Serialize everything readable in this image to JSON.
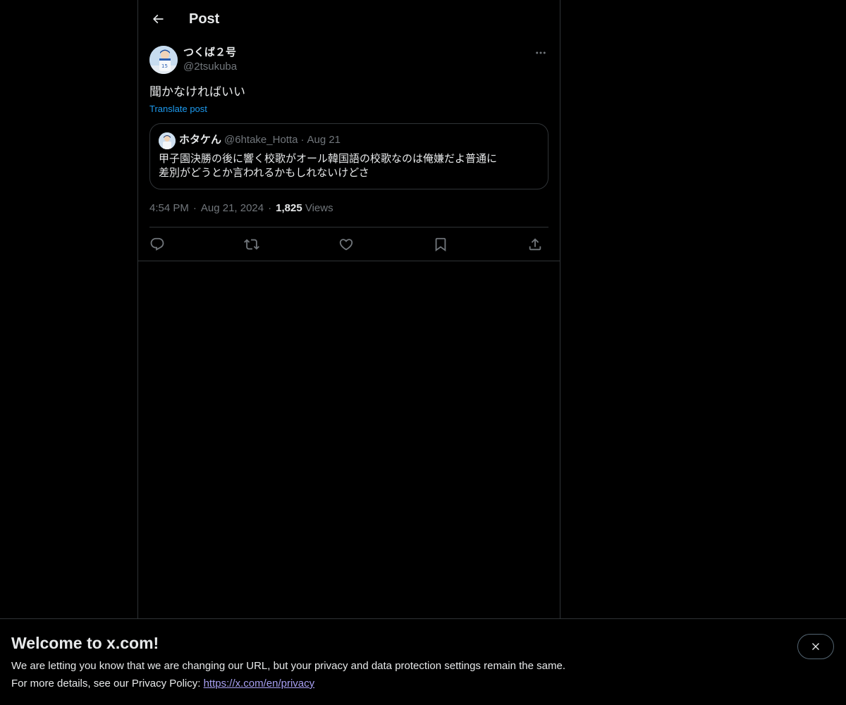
{
  "header": {
    "back_icon": "arrow-left-icon",
    "title": "Post"
  },
  "post": {
    "author_name": "つくば２号",
    "author_handle": "@2tsukuba",
    "text": "聞かなければいい",
    "translate_label": "Translate post",
    "time": "4:54 PM",
    "date": "Aug 21, 2024",
    "views_count": "1,825",
    "views_label": "Views",
    "separator": "·"
  },
  "quote": {
    "author_name": "ホタケん",
    "author_handle": "@6htake_Hotta",
    "separator": "·",
    "date": "Aug 21",
    "text_line1": "甲子園決勝の後に響く校歌がオール韓国語の校歌なのは俺嫌だよ普通に",
    "text_line2": "差別がどうとか言われるかもしれないけどさ"
  },
  "actions": {
    "reply_icon": "reply-icon",
    "repost_icon": "repost-icon",
    "like_icon": "heart-icon",
    "bookmark_icon": "bookmark-icon",
    "share_icon": "share-icon"
  },
  "banner": {
    "title": "Welcome to x.com!",
    "line1": "We are letting you know that we are changing our URL, but your privacy and data protection settings remain the same.",
    "line2_prefix": "For more details, see our Privacy Policy: ",
    "link_text": "https://x.com/en/privacy",
    "close_icon": "close-icon"
  },
  "colors": {
    "background": "#000000",
    "text_primary": "#e7e9ea",
    "text_secondary": "#71767b",
    "accent": "#1d9bf0",
    "border": "#2f3336",
    "link_visited": "#a79ff2"
  }
}
